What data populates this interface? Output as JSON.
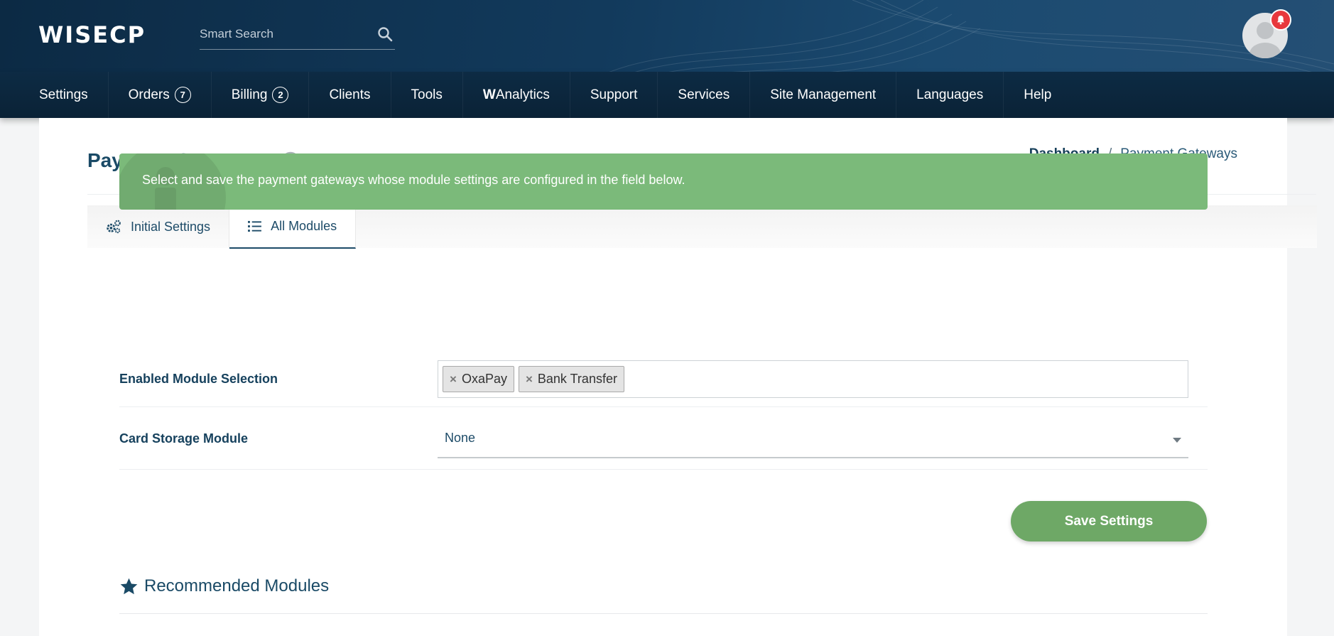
{
  "header": {
    "logo": "WISECP",
    "search_placeholder": "Smart Search",
    "notification_count": ""
  },
  "nav": {
    "items": [
      {
        "label": "Settings",
        "count": ""
      },
      {
        "label": "Orders",
        "count": "7"
      },
      {
        "label": "Billing",
        "count": "2"
      },
      {
        "label": "Clients",
        "count": ""
      },
      {
        "label": "Tools",
        "count": ""
      },
      {
        "label_bold": "W",
        "label": "Analytics",
        "count": ""
      },
      {
        "label": "Support",
        "count": ""
      },
      {
        "label": "Services",
        "count": ""
      },
      {
        "label": "Site Management",
        "count": ""
      },
      {
        "label": "Languages",
        "count": ""
      },
      {
        "label": "Help",
        "count": ""
      }
    ]
  },
  "page": {
    "title": "Payment Gateways",
    "breadcrumb": {
      "home": "Dashboard",
      "separator": "/",
      "current": "Payment Gateways"
    }
  },
  "tabs": [
    {
      "label": "Initial Settings",
      "icon": "gears-icon"
    },
    {
      "label": "All Modules",
      "icon": "list-icon"
    }
  ],
  "alert": {
    "text": "Select and save the payment gateways whose module settings are configured in the field below."
  },
  "form": {
    "enabled_label": "Enabled Module Selection",
    "enabled_tags": [
      "OxaPay",
      "Bank Transfer"
    ],
    "tag_remove": "×",
    "card_storage_label": "Card Storage Module",
    "card_storage_value": "None",
    "save_label": "Save Settings"
  },
  "recommended": {
    "title": "Recommended Modules"
  },
  "colors": {
    "brand_dark": "#0c2a44",
    "alert_green": "#7bba7a",
    "button_green": "#6ea866",
    "text_primary": "#1a4a66",
    "badge_red": "#e8383d"
  }
}
